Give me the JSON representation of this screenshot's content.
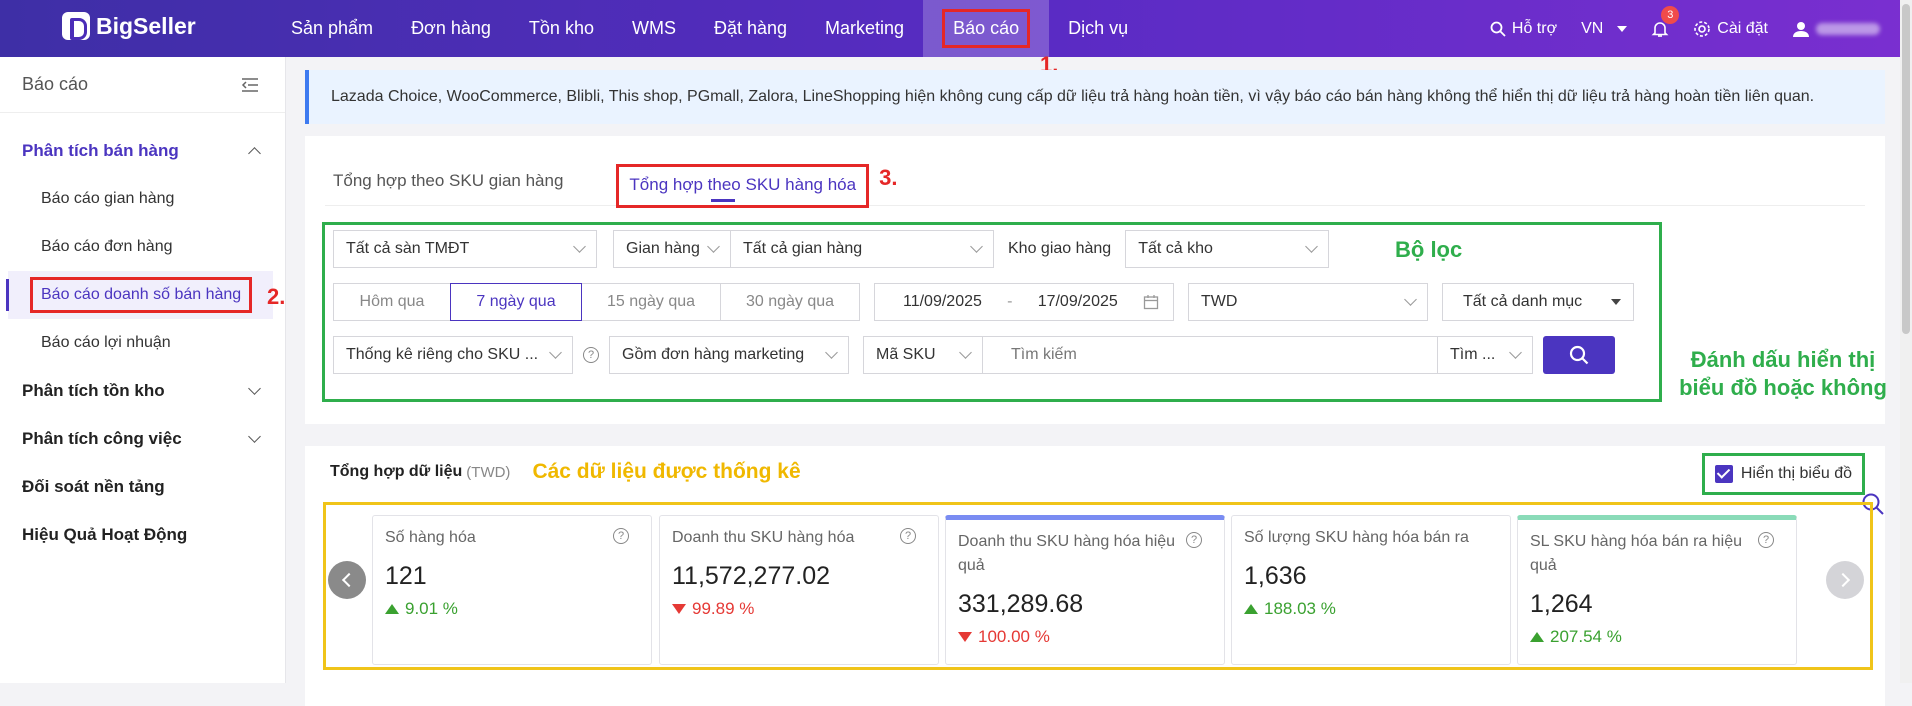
{
  "topbar": {
    "brand": "BigSeller",
    "nav": [
      "Sản phẩm",
      "Đơn hàng",
      "Tồn kho",
      "WMS",
      "Đặt hàng",
      "Marketing",
      "Báo cáo",
      "Dịch vụ"
    ],
    "active_nav": "Báo cáo",
    "support": "Hỗ trợ",
    "language": "VN",
    "notification_count": "3",
    "settings": "Cài đặt"
  },
  "sidebar": {
    "title": "Báo cáo",
    "groups": [
      {
        "label": "Phân tích bán hàng",
        "open": true,
        "items": [
          "Báo cáo gian hàng",
          "Báo cáo đơn hàng",
          "Báo cáo doanh số bán hàng",
          "Báo cáo lợi nhuận"
        ],
        "active_item": "Báo cáo doanh số bán hàng"
      },
      {
        "label": "Phân tích tồn kho"
      },
      {
        "label": "Phân tích công việc"
      },
      {
        "label": "Đối soát nền tảng"
      },
      {
        "label": "Hiệu Quả Hoạt Động"
      }
    ]
  },
  "notice": "Lazada Choice, WooCommerce, Blibli, This shop, PGmall, Zalora, LineShopping hiện không cung cấp dữ liệu trả hàng hoàn tiền, vì vậy báo cáo bán hàng không thể hiển thị dữ liệu trả hàng hoàn tiền liên quan.",
  "tabs": {
    "tab1": "Tổng hợp theo SKU gian hàng",
    "tab2": "Tổng hợp theo SKU hàng hóa"
  },
  "filters": {
    "platform": "Tất cả sàn TMĐT",
    "shop_type": "Gian hàng",
    "shop": "Tất cả gian hàng",
    "warehouse_label": "Kho giao hàng",
    "warehouse": "Tất cả kho",
    "date_presets": [
      "Hôm qua",
      "7 ngày qua",
      "15 ngày qua",
      "30 ngày qua"
    ],
    "active_preset": "7 ngày qua",
    "date_from": "11/09/2025",
    "date_sep": "-",
    "date_to": "17/09/2025",
    "currency": "TWD",
    "category": "Tất cả danh mục",
    "stat_mode": "Thống kê riêng cho SKU ...",
    "marketing": "Gồm đơn hàng marketing",
    "search_field": "Mã SKU",
    "search_placeholder": "Tìm kiếm",
    "search_mode": "Tìm ..."
  },
  "summary": {
    "title": "Tổng hợp dữ liệu",
    "currency_note": "(TWD)",
    "show_chart": "Hiển thị biểu đồ",
    "cards": [
      {
        "title": "Số hàng hóa",
        "value": "121",
        "change": "9.01 %",
        "trend": "up"
      },
      {
        "title": "Doanh thu SKU hàng hóa",
        "value": "11,572,277.02",
        "change": "99.89 %",
        "trend": "down"
      },
      {
        "title": "Doanh thu SKU hàng hóa hiệu quả",
        "value": "331,289.68",
        "change": "100.00 %",
        "trend": "down"
      },
      {
        "title": "Số lượng SKU hàng hóa bán ra",
        "value": "1,636",
        "change": "188.03 %",
        "trend": "up"
      },
      {
        "title": "SL SKU hàng hóa bán ra hiệu quả",
        "value": "1,264",
        "change": "207.54 %",
        "trend": "up"
      }
    ]
  },
  "annotations": {
    "step1": "1.",
    "step2": "2.",
    "step3": "3.",
    "filter_note": "Bộ lọc",
    "chart_note_1": "Đánh dấu hiển thị",
    "chart_note_2": "biểu đồ hoặc không",
    "data_note": "Các dữ liệu được thống kê"
  },
  "colors": {
    "brand": "#4b35c0",
    "annotation_red": "#e52727",
    "annotation_green": "#2fae4c",
    "annotation_yellow": "#f0c419"
  }
}
